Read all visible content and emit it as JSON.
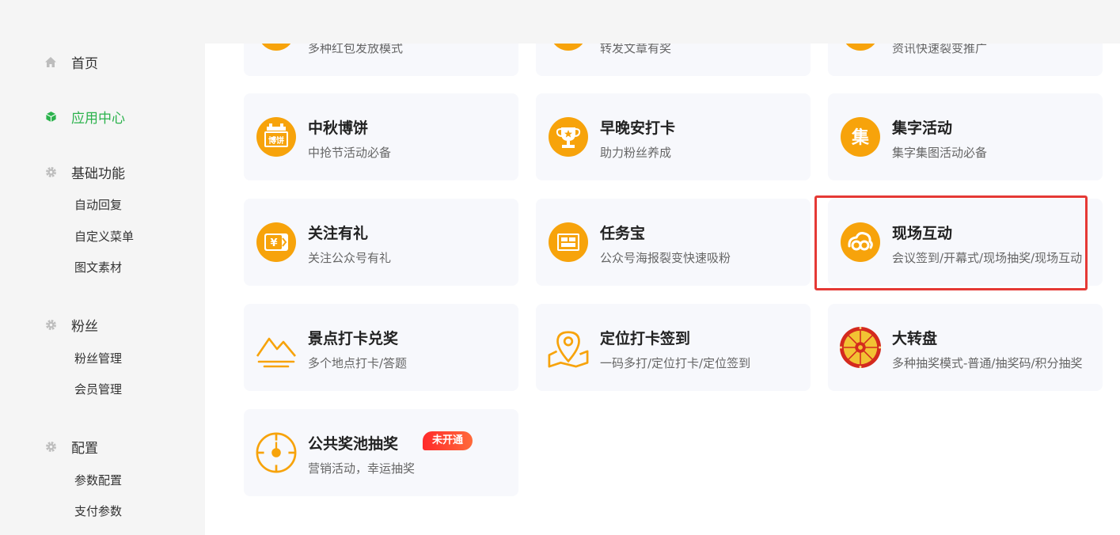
{
  "sidebar": {
    "items": [
      {
        "label": "首页",
        "icon": "home-icon"
      },
      {
        "label": "应用中心",
        "icon": "cube-icon",
        "active": true
      },
      {
        "label": "基础功能",
        "icon": "gear-icon",
        "children": [
          "自动回复",
          "自定义菜单",
          "图文素材"
        ]
      },
      {
        "label": "粉丝",
        "icon": "gear-icon",
        "children": [
          "粉丝管理",
          "会员管理"
        ]
      },
      {
        "label": "配置",
        "icon": "gear-icon",
        "children": [
          "参数配置",
          "支付参数"
        ]
      }
    ]
  },
  "apps": [
    {
      "title": "",
      "desc": "多种红包发放模式",
      "icon": "coin-icon"
    },
    {
      "title": "",
      "desc": "转发文章有奖",
      "icon": "coin-icon"
    },
    {
      "title": "",
      "desc": "资讯快速裂变推广",
      "icon": "coin-icon"
    },
    {
      "title": "中秋博饼",
      "desc": "中抢节活动必备",
      "icon": "mooncake-icon",
      "icon_text": "博饼"
    },
    {
      "title": "早晚安打卡",
      "desc": "助力粉丝养成",
      "icon": "trophy-icon"
    },
    {
      "title": "集字活动",
      "desc": "集字集图活动必备",
      "icon": "ji-character-icon",
      "icon_text": "集"
    },
    {
      "title": "关注有礼",
      "desc": "关注公众号有礼",
      "icon": "gift-card-icon",
      "icon_text": "¥"
    },
    {
      "title": "任务宝",
      "desc": "公众号海报裂变快速吸粉",
      "icon": "task-box-icon"
    },
    {
      "title": "现场互动",
      "desc": "会议签到/开幕式/现场抽奖/现场互动",
      "icon": "cloud-loop-icon"
    },
    {
      "title": "景点打卡兑奖",
      "desc": "多个地点打卡/答题",
      "icon": "mountain-icon"
    },
    {
      "title": "定位打卡签到",
      "desc": "一码多打/定位打卡/定位签到",
      "icon": "location-map-icon"
    },
    {
      "title": "大转盘",
      "desc": "多种抽奖模式-普通/抽奖码/积分抽奖",
      "icon": "wheel-icon"
    },
    {
      "title": "公共奖池抽奖",
      "desc": "营销活动，幸运抽奖",
      "icon": "target-icon",
      "badge": "未开通"
    }
  ],
  "colors": {
    "accent": "#2bb24c",
    "icon_orange": "#f7a30b",
    "highlight": "#e53935",
    "badge": "#ff3b30"
  }
}
